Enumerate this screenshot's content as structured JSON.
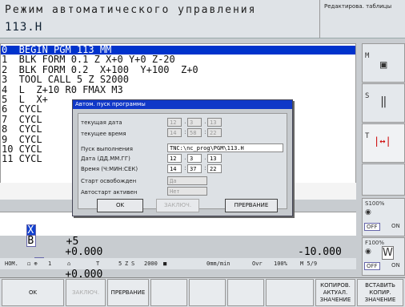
{
  "header": {
    "title": "Режим автоматического управления",
    "file": "113.H",
    "right_title": "Редактирова. таблицы"
  },
  "program": {
    "lines": [
      {
        "text": "0  BEGIN PGM 113 MM",
        "selected": true
      },
      {
        "text": "1  BLK FORM 0.1 Z X+0 Y+0 Z-20",
        "selected": false
      },
      {
        "text": "2  BLK FORM 0.2  X+100  Y+100  Z+0",
        "selected": false
      },
      {
        "text": "3  TOOL CALL 5 Z S2000",
        "selected": false
      },
      {
        "text": "4  L  Z+10 R0 FMAX M3",
        "selected": false
      },
      {
        "text": "5  L  X+",
        "selected": false
      },
      {
        "text": "6  CYCL",
        "selected": false
      },
      {
        "text": "7  CYCL",
        "selected": false
      },
      {
        "text": "8  CYCL",
        "selected": false
      },
      {
        "text": "9  CYCL",
        "selected": false
      },
      {
        "text": "10 CYCL",
        "selected": false
      },
      {
        "text": "11 CYCL",
        "selected": false
      }
    ],
    "overflow_N": "N"
  },
  "positions": {
    "row1": {
      "axis": "X",
      "value": "+5",
      "axis2": "",
      "value2": "",
      "axis3": "",
      "value3": "-10.000"
    },
    "row2": {
      "axis": "B",
      "value": "+0.000",
      "axis2": "C",
      "value2": "+0.000"
    }
  },
  "status": {
    "mode": "НОМ.",
    "tool_label": "T",
    "tool": "5",
    "spindle_axis": "Z",
    "s_label": "S",
    "speed": "2000",
    "feed": "0mm/min",
    "ovr_label": "Ovr",
    "ovr": "100%",
    "m": "M 5/9",
    "one": "1"
  },
  "sidebar": {
    "m_label": "M",
    "s_label": "S",
    "t_label": "T",
    "s100": "S100%",
    "f100": "F100%",
    "off": "OFF",
    "on": "ON"
  },
  "dialog": {
    "title": "Автом. пуск программы",
    "labels": [
      "текущая дата",
      "текущее время",
      "Пуск выполнения программы",
      "Дата (ДД.ММ.ГГ)",
      "Время (Ч:МИН:СЕК)",
      "Старт освобожден",
      "Автостарт активен"
    ],
    "cur_date": [
      "12",
      "3",
      "13"
    ],
    "cur_time": [
      "14",
      "58",
      "22"
    ],
    "path": "TNC:\\nc_prog\\PGM\\113.H",
    "date": [
      "12",
      "3",
      "13"
    ],
    "time": [
      "14",
      "37",
      "22"
    ],
    "released": "Да",
    "autostart": "Нет",
    "ok": "OK",
    "close": "ЗАКЛЮЧ.",
    "abort": "ПРЕРВАНИЕ"
  },
  "softkeys": {
    "ok": "OK",
    "close": "ЗАКЛЮЧ.",
    "abort": "ПРЕРВАНИЕ",
    "copy": "КОПИРОВ. АКТУАЛ. ЗНАЧЕНИЕ",
    "paste": "ВСТАВИТЬ КОПИР. ЗНАЧЕНИЕ"
  }
}
